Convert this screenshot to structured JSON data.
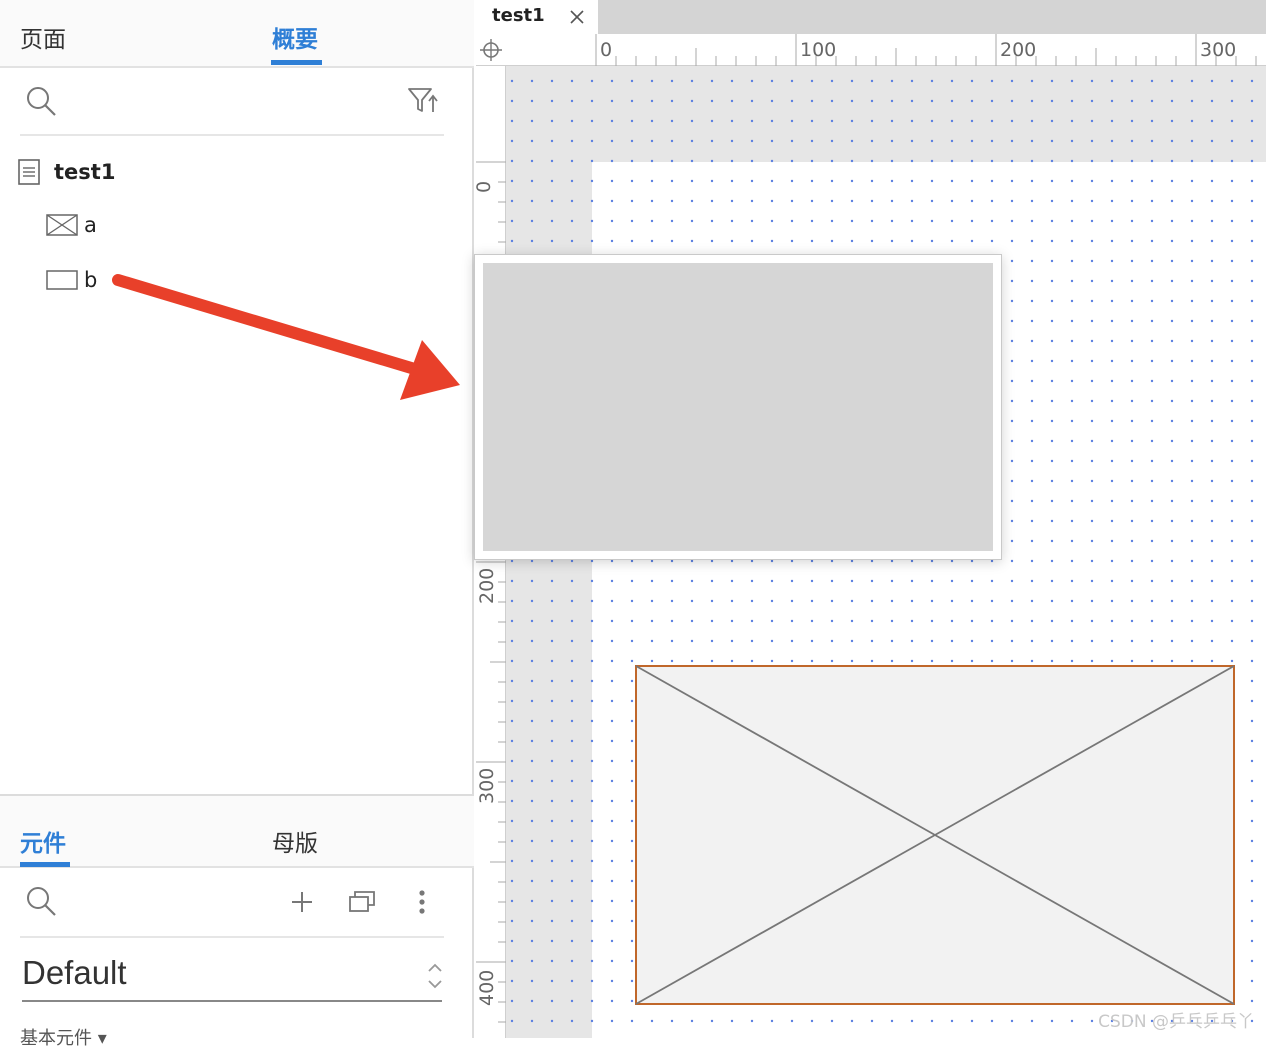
{
  "left_panel": {
    "top_tabs": [
      {
        "label": "页面",
        "active": false
      },
      {
        "label": "概要",
        "active": true
      }
    ],
    "outline": {
      "page_name": "test1",
      "items": [
        {
          "label": "a",
          "icon": "image-placeholder-icon"
        },
        {
          "label": "b",
          "icon": "rectangle-icon"
        }
      ]
    },
    "bottom_tabs": [
      {
        "label": "元件",
        "active": true
      },
      {
        "label": "母版",
        "active": false
      }
    ],
    "library": {
      "selected": "Default",
      "section_label": "基本元件 ▾"
    }
  },
  "editor": {
    "tab_title": "test1",
    "ruler_top": [
      "0",
      "100",
      "200",
      "300"
    ],
    "ruler_left": [
      "0",
      "200",
      "300",
      "400"
    ]
  },
  "watermark": "CSDN @乒乓乒乓丫",
  "colors": {
    "accent": "#2f7fd6",
    "grid_dot": "#5b7fe0",
    "arrow": "#e8402a",
    "selection_border": "#c0672a"
  }
}
